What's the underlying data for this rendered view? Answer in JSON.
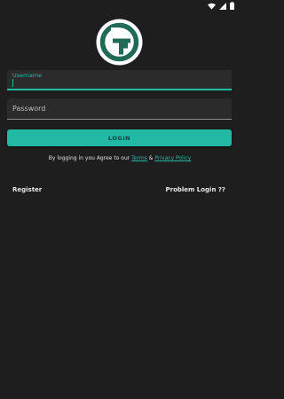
{
  "status_bar": {
    "icons": [
      "wifi-icon",
      "signal-icon",
      "battery-icon"
    ]
  },
  "logo": {
    "name": "gt-logo",
    "colors": {
      "ring": "#1f6b56",
      "background": "#ffffff"
    }
  },
  "form": {
    "username": {
      "label": "Username",
      "value": ""
    },
    "password": {
      "placeholder": "Password",
      "value": ""
    },
    "login_label": "LOGIN"
  },
  "terms": {
    "prefix": "By logging in you Agree to our ",
    "terms_link": "Terms",
    "separator": " & ",
    "privacy_link": "Privacy Policy"
  },
  "links": {
    "register": "Register",
    "problem_login": "Problem Login ??"
  },
  "colors": {
    "background": "#1e1e1e",
    "accent": "#21b9a4",
    "field": "#2b2b2b"
  }
}
